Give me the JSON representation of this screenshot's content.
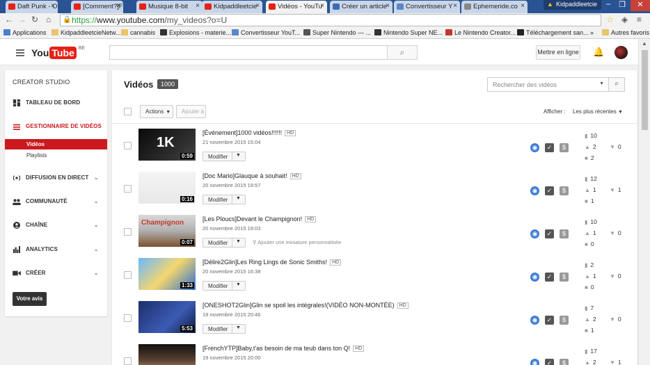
{
  "browser": {
    "tabs": [
      {
        "label": "Daft Punk - One",
        "fav": "#e62117",
        "active": false
      },
      {
        "label": "[Comment?]Fai",
        "fav": "#e62117",
        "active": false
      },
      {
        "label": "Musique 8-bit",
        "fav": "#e62117",
        "active": false
      },
      {
        "label": "Kidpaddleetcie",
        "fav": "#e62117",
        "active": false
      },
      {
        "label": "Vidéos - YouTu",
        "fav": "#e62117",
        "active": true
      },
      {
        "label": "Créer un article",
        "fav": "#3b6bb5",
        "active": false
      },
      {
        "label": "Convertisseur Y",
        "fav": "#5a87c8",
        "active": false
      },
      {
        "label": "Ephemeride.co",
        "fav": "#888888",
        "active": false
      }
    ],
    "profile": "Kidpaddleetcie",
    "window_controls": {
      "minimize": "–",
      "maximize": "❐",
      "close": "✕"
    },
    "url": {
      "scheme": "https://",
      "host": "www.youtube.com",
      "path": "/my_videos?o=U"
    },
    "bookmarks": [
      {
        "label": "Applications",
        "icon": "apps-icon",
        "color": "#4a7fd0"
      },
      {
        "label": "KidpaddleetcieNetw...",
        "icon": "folder-icon",
        "color": "#e9c46a"
      },
      {
        "label": "cannabis",
        "icon": "folder-icon",
        "color": "#e9c46a"
      },
      {
        "label": "Explosions - materie...",
        "icon": "site-icon",
        "color": "#333333"
      },
      {
        "label": "Convertisseur YouT...",
        "icon": "site-icon",
        "color": "#5a87c8"
      },
      {
        "label": "Super Nintendo — ...",
        "icon": "wiki-icon",
        "color": "#555555"
      },
      {
        "label": "Nintendo Super NE...",
        "icon": "site-icon",
        "color": "#333333"
      },
      {
        "label": "Le Nintendo Creator...",
        "icon": "site-icon",
        "color": "#c0392b"
      },
      {
        "label": "Téléchargement san...",
        "icon": "site-icon",
        "color": "#222222"
      },
      {
        "label": "»",
        "icon": "",
        "color": ""
      },
      {
        "label": "Autres favoris",
        "icon": "folder-icon",
        "color": "#e9c46a"
      }
    ]
  },
  "header": {
    "logo_you": "You",
    "logo_tube": "Tube",
    "region": "BE",
    "upload_label": "Mettre en ligne"
  },
  "sidebar": {
    "title": "CREATOR STUDIO",
    "items": [
      {
        "label": "TABLEAU DE BORD",
        "icon": "dashboard-icon",
        "red": false
      },
      {
        "label": "GESTIONNAIRE DE VIDÉOS",
        "icon": "video-manager-icon",
        "red": true
      },
      {
        "label": "DIFFUSION EN DIRECT",
        "icon": "live-icon",
        "red": false
      },
      {
        "label": "COMMUNAUTÉ",
        "icon": "community-icon",
        "red": false
      },
      {
        "label": "CHAÎNE",
        "icon": "channel-icon",
        "red": false
      },
      {
        "label": "ANALYTICS",
        "icon": "analytics-icon",
        "red": false
      },
      {
        "label": "CRÉER",
        "icon": "create-icon",
        "red": false
      }
    ],
    "sub_videos": "Vidéos",
    "sub_playlists": "Playlists",
    "feedback": "Votre avis"
  },
  "main": {
    "title": "Vidéos",
    "count": "1000",
    "search_placeholder": "Rechercher des vidéos",
    "actions_label": "Actions",
    "add_to_label": "Ajouter à",
    "sort_label": "Afficher :",
    "sort_value": "Les plus récentes",
    "modify_label": "Modifier",
    "add_thumb_label": "Ajouter une miniature personnalisée"
  },
  "videos": [
    {
      "title": "[Événement]1000 vidéos!!!!!!",
      "date": "21 novembre 2015 15:04",
      "duration": "0:59",
      "views": "10",
      "likes": "2",
      "comments": "2",
      "dislikes": "0",
      "thumb": "1K"
    },
    {
      "title": "[Doc Mario]Glauque à souhait!",
      "date": "20 novembre 2015 19:57",
      "duration": "0:16",
      "views": "12",
      "likes": "1",
      "comments": "1",
      "dislikes": "1",
      "thumb": ""
    },
    {
      "title": "[Les Ploucs]Devant le Champignon!",
      "date": "20 novembre 2015 19:03",
      "duration": "0:07",
      "views": "10",
      "likes": "1",
      "comments": "0",
      "dislikes": "0",
      "thumb": "Champignon"
    },
    {
      "title": "[Délire2Glin]Les Ring Lings de Sonic Smiths!",
      "date": "20 novembre 2015 16:38",
      "duration": "1:33",
      "views": "2",
      "likes": "1",
      "comments": "0",
      "dislikes": "0",
      "thumb": ""
    },
    {
      "title": "[ONESHOT2Glin]Glin se spoil les intégrales!(VIDÉO NON-MONTÉE)",
      "date": "19 novembre 2015 20:46",
      "duration": "5:53",
      "views": "7",
      "likes": "2",
      "comments": "1",
      "dislikes": "0",
      "thumb": ""
    },
    {
      "title": "[FrenchYTP]Baby,t'as besoin de ma teub dans ton Q!",
      "date": "19 novembre 2015 20:00",
      "duration": "",
      "views": "17",
      "likes": "2",
      "comments": "",
      "dislikes": "1",
      "thumb": ""
    }
  ],
  "hd_badge": "HD"
}
